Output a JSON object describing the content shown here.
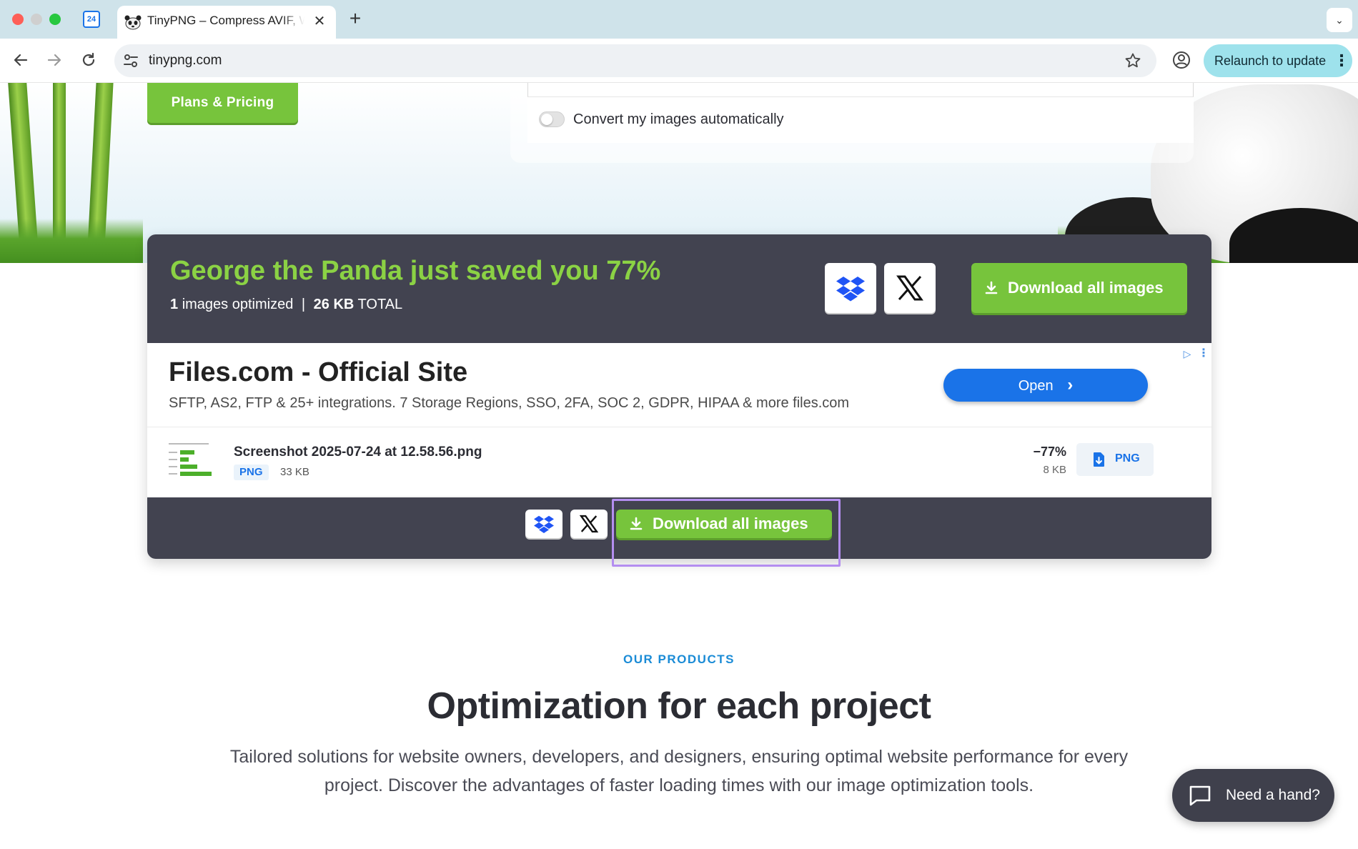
{
  "browser": {
    "pinned_tab_label": "24",
    "tab_title": "TinyPNG – Compress AVIF, WebP, PNG and JPEG images",
    "tab_close": "✕",
    "new_tab": "+",
    "tab_menu": "⌄",
    "url": "tinypng.com",
    "relaunch_label": "Relaunch to update",
    "relaunch_menu": "⋮"
  },
  "hero": {
    "plans_button": "Plans & Pricing",
    "convert_label": "Convert my images automatically",
    "convert_enabled": false
  },
  "results": {
    "title": "George the Panda just saved you 77%",
    "images_count": "1",
    "images_label": "images optimized",
    "separator": "|",
    "total_size": "26 KB",
    "total_label": "TOTAL",
    "download_all": "Download all images"
  },
  "ad": {
    "title": "Files.com - Official Site",
    "description": "SFTP, AS2, FTP & 25+ integrations. 7 Storage Regions, SSO, 2FA, SOC 2, GDPR, HIPAA & more files.com",
    "open_button": "Open",
    "open_arrow": "›",
    "choices_icon": "▷",
    "menu_icon": "⋮"
  },
  "file": {
    "name": "Screenshot 2025-07-24 at 12.58.56.png",
    "type": "PNG",
    "original_size": "33 KB",
    "reduction": "−77%",
    "new_size": "8 KB",
    "download_label": "PNG"
  },
  "products": {
    "eyebrow": "OUR PRODUCTS",
    "title": "Optimization for each project",
    "description": "Tailored solutions for website owners, developers, and designers, ensuring optimal website performance for every project. Discover the advantages of faster loading times with our image optimization tools."
  },
  "help": {
    "label": "Need a hand?"
  },
  "colors": {
    "brand_green": "#77c43c",
    "headline_green": "#8bd244",
    "panel_dark": "#424350",
    "link_blue": "#1a73e8",
    "focus_purple": "#b48ef0"
  }
}
